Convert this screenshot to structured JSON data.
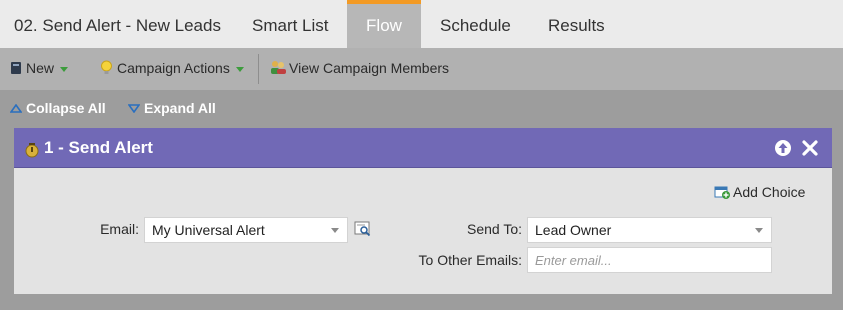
{
  "tabs": [
    {
      "label": "02. Send Alert - New Leads"
    },
    {
      "label": "Smart List"
    },
    {
      "label": "Flow"
    },
    {
      "label": "Schedule"
    },
    {
      "label": "Results"
    }
  ],
  "active_tab": "Flow",
  "toolbar": {
    "new_label": "New",
    "campaign_actions_label": "Campaign Actions",
    "view_members_label": "View Campaign Members"
  },
  "collapse_label": "Collapse All",
  "expand_label": "Expand All",
  "step": {
    "title": "1 - Send Alert",
    "add_choice_label": "Add Choice",
    "email_label": "Email:",
    "email_value": "My Universal Alert",
    "send_to_label": "Send To:",
    "send_to_value": "Lead Owner",
    "other_emails_label": "To Other Emails:",
    "other_emails_placeholder": "Enter email..."
  },
  "colors": {
    "accent": "#f39a24",
    "step_header": "#7169b6",
    "dropdown_arrow": "#3c9c3c"
  }
}
